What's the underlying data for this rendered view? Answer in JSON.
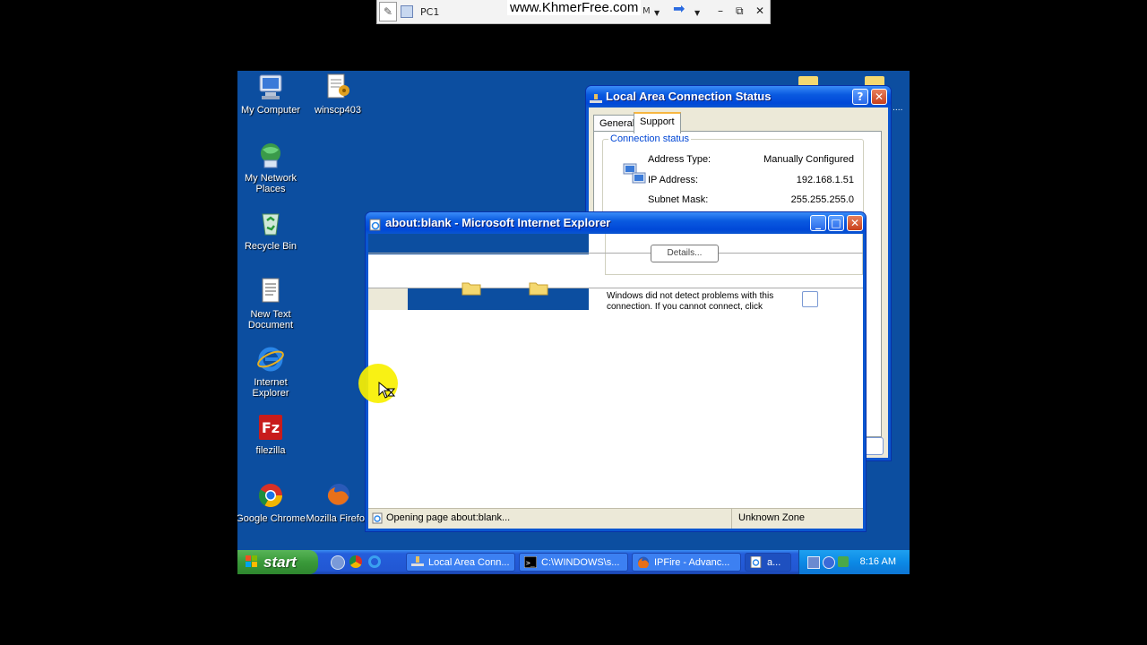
{
  "watermark": "www.KhmerFree.com",
  "remote_bar": {
    "pc_name": "PC1",
    "m_fragment": "M"
  },
  "desktop_icons": [
    {
      "label": "My Computer"
    },
    {
      "label": "winscp403"
    },
    {
      "label": "My Network Places"
    },
    {
      "label": "Recycle Bin"
    },
    {
      "label": "New Text Document"
    },
    {
      "label": "Internet Explorer"
    },
    {
      "label": "filezilla"
    },
    {
      "label": "Google Chrome"
    },
    {
      "label": "Mozilla Firefox"
    }
  ],
  "lac_window": {
    "title": "Local Area Connection Status",
    "tabs": [
      "General",
      "Support"
    ],
    "active_tab": "Support",
    "group_label": "Connection status",
    "rows": [
      {
        "key": "Address Type:",
        "value": "Manually Configured"
      },
      {
        "key": "IP Address:",
        "value": "192.168.1.51"
      },
      {
        "key": "Subnet Mask:",
        "value": "255.255.255.0"
      }
    ],
    "details_button": "Details...",
    "detect_text_1": "Windows did not detect problems with this",
    "detect_text_2": "connection. If you cannot connect, click"
  },
  "ie_window": {
    "title": "about:blank - Microsoft Internet Explorer",
    "status_text": "Opening page about:blank...",
    "zone": "Unknown Zone"
  },
  "taskbar": {
    "start": "start",
    "tasks": [
      {
        "label": "Local Area Conn..."
      },
      {
        "label": "C:\\WINDOWS\\s..."
      },
      {
        "label": "IPFire - Advanc..."
      },
      {
        "label": "a..."
      }
    ],
    "clock": "8:16 AM"
  },
  "colors": {
    "desktop": "#0c4ea0",
    "taskbar": "#245edb",
    "start": "#3a9a3a",
    "cursor_highlight": "#f8f000"
  }
}
